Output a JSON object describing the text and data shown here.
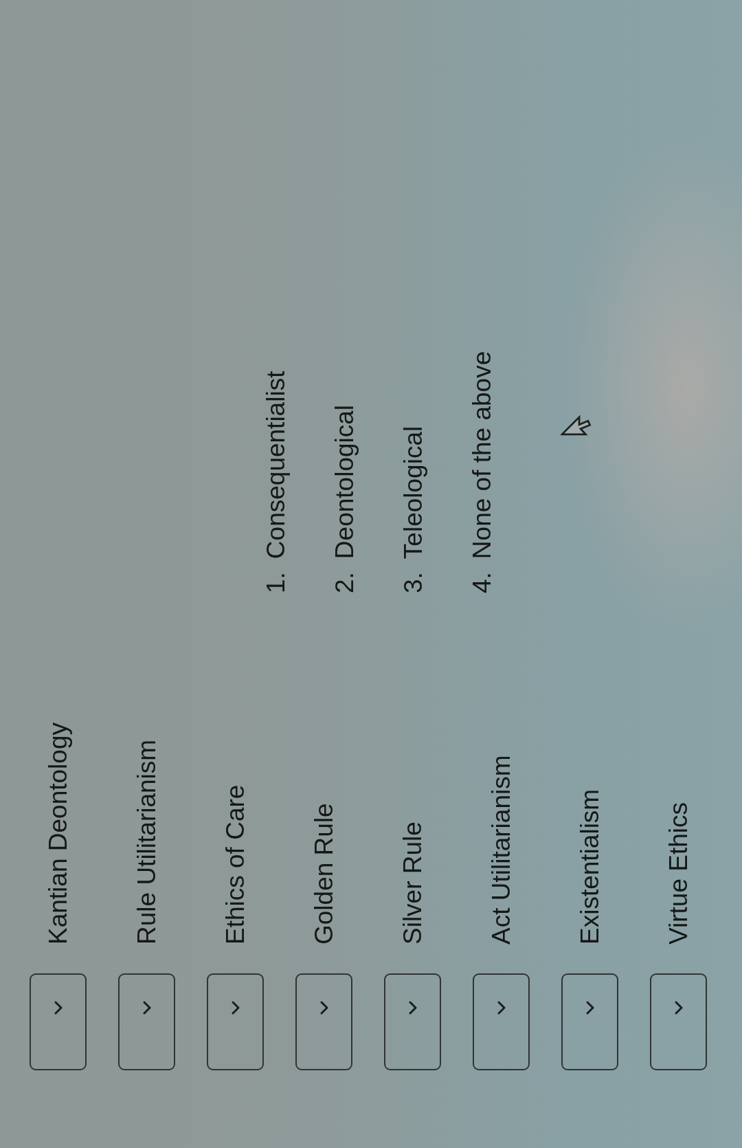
{
  "matching_question": {
    "premises": [
      {
        "label": "Kantian Deontology"
      },
      {
        "label": "Rule Utilitarianism"
      },
      {
        "label": "Ethics of Care"
      },
      {
        "label": "Golden Rule"
      },
      {
        "label": "Silver Rule"
      },
      {
        "label": "Act Utilitarianism"
      },
      {
        "label": "Existentialism"
      },
      {
        "label": "Virtue Ethics"
      }
    ],
    "options": [
      {
        "number": "1.",
        "text": "Consequentialist"
      },
      {
        "number": "2.",
        "text": "Deontological"
      },
      {
        "number": "3.",
        "text": "Teleological"
      },
      {
        "number": "4.",
        "text": "None of the above"
      }
    ]
  }
}
